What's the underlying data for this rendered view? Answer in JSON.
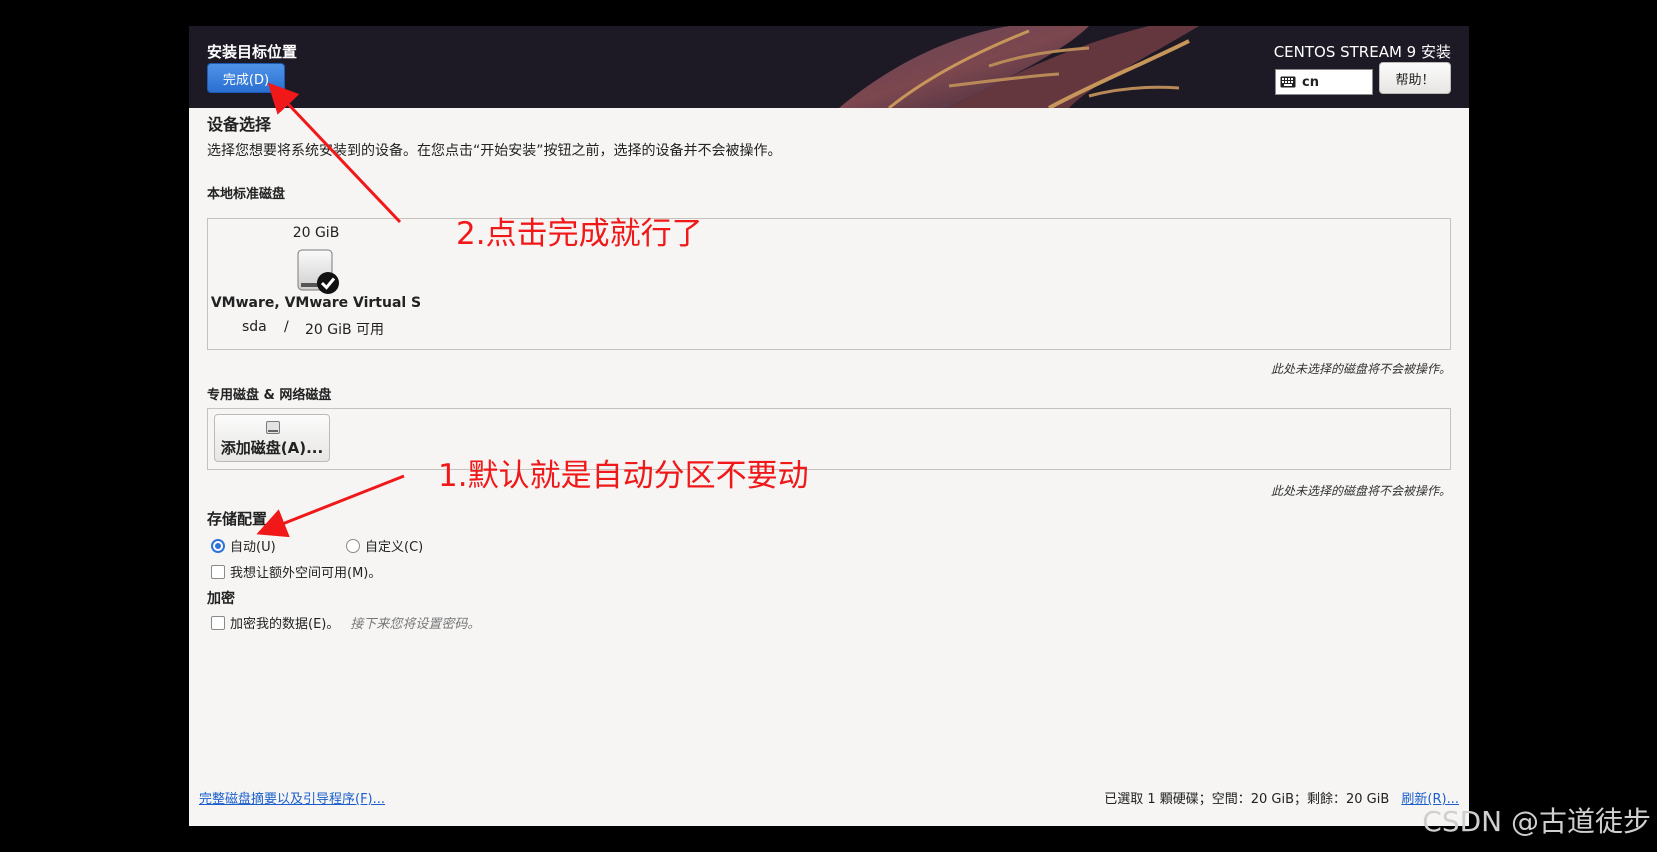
{
  "header": {
    "title": "安装目标位置",
    "done_label": "完成(D)",
    "product": "CENTOS STREAM 9 安装",
    "keyboard_layout": "cn",
    "help_label": "帮助！"
  },
  "device_selection": {
    "title": "设备选择",
    "description": "选择您想要将系统安装到的设备。在您点击“开始安装”按钮之前，选择的设备并不会被操作。"
  },
  "local_disks": {
    "title": "本地标准磁盘",
    "disk": {
      "size": "20 GiB",
      "name": "VMware, VMware Virtual S",
      "device": "sda",
      "separator": "/",
      "free": "20 GiB 可用"
    },
    "note": "此处未选择的磁盘将不会被操作。"
  },
  "special_disks": {
    "title": "专用磁盘 & 网络磁盘",
    "add_label": "添加磁盘(A)...",
    "note": "此处未选择的磁盘将不会被操作。"
  },
  "storage": {
    "title": "存储配置",
    "auto_label": "自动(U)",
    "custom_label": "自定义(C)",
    "extra_space_label": "我想让额外空间可用(M)。"
  },
  "encryption": {
    "title": "加密",
    "encrypt_label": "加密我的数据(E)。",
    "hint": "接下来您将设置密码。"
  },
  "footer": {
    "summary_link": "完整磁盘摘要以及引导程序(F)...",
    "status": "已選取 1 顆硬碟；空間：20 GiB；剩餘：20 GiB",
    "refresh_link": "刷新(R)..."
  },
  "annotations": {
    "step2": "2.点击完成就行了",
    "step1": "1.默认就是自动分区不要动"
  },
  "watermark": "CSDN @古道徒步",
  "colors": {
    "accent": "#2e74d6",
    "annotation": "#f01818",
    "header_bg": "#1d1a26"
  }
}
